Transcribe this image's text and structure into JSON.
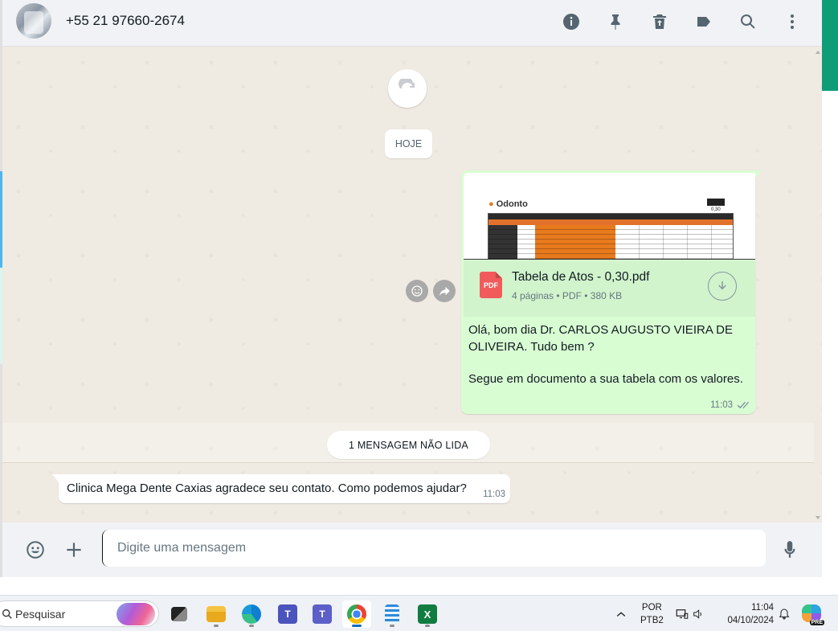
{
  "header": {
    "contact_name": "+55 21 97660-2674",
    "icons": [
      "info-icon",
      "pin-icon",
      "delete-icon",
      "label-icon",
      "search-icon",
      "menu-icon"
    ]
  },
  "chat": {
    "date_chip": "HOJE",
    "outgoing": {
      "pdf_thumb_logo": "Odonto",
      "pdf_thumb_value": "0,30",
      "file_name": "Tabela de Atos - 0,30.pdf",
      "file_type_badge": "PDF",
      "file_pages": "4 páginas",
      "file_type": "PDF",
      "file_size": "380 KB",
      "text_line1": "Olá, bom dia Dr. CARLOS AUGUSTO VIEIRA DE OLIVEIRA. Tudo bem ?",
      "text_line2": "Segue em documento a sua tabela com os valores.",
      "time": "11:03"
    },
    "unread_divider": "1 MENSAGEM NÃO LIDA",
    "incoming": {
      "text": "Clinica Mega Dente Caxias agradece seu contato. Como podemos ajudar?",
      "time": "11:03"
    }
  },
  "composer": {
    "placeholder": "Digite uma mensagem"
  },
  "taskbar": {
    "search_label": "Pesquisar",
    "lang_top": "POR",
    "lang_bottom": "PTB2",
    "time": "11:04",
    "date": "04/10/2024",
    "copilot_badge": "PRE"
  },
  "colors": {
    "outgoing_bubble": "#d9fdd3",
    "chat_bg": "#efeae2",
    "header_bg": "#f0f2f5",
    "accent_green": "#0f9d78"
  }
}
